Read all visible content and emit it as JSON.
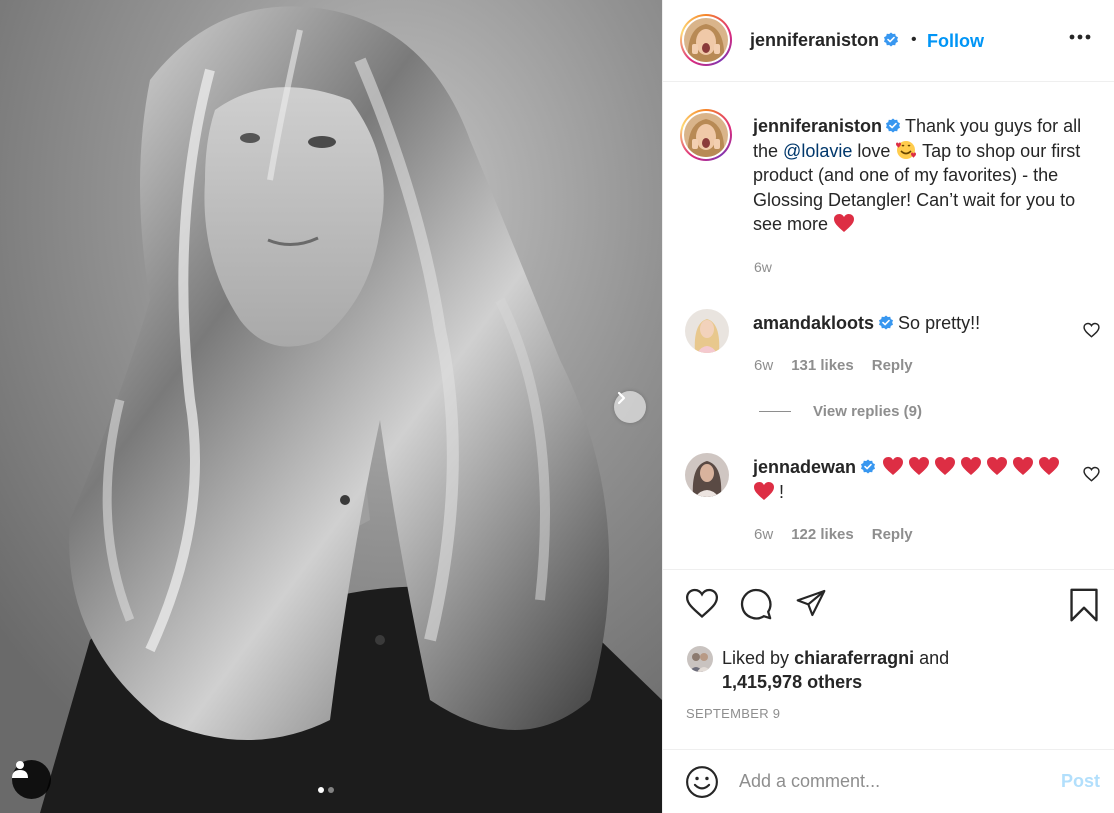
{
  "post": {
    "author": "jenniferaniston",
    "header_separator": "•",
    "follow_label": "Follow",
    "caption_text_1": "Thank you guys for all the",
    "caption_mention": "@lolavie",
    "caption_text_2": "love",
    "caption_text_3": "Tap to shop our first product (and one of my favorites) - the Glossing Detangler! Can’t wait for you to see more",
    "caption_time": "6w",
    "carousel_slides": 2,
    "carousel_active_index": 0
  },
  "comments": [
    {
      "user": "amandakloots",
      "text": "So pretty!!",
      "time": "6w",
      "likes": "131 likes",
      "reply_label": "Reply",
      "view_replies": "View replies (9)"
    },
    {
      "user": "jennadewan",
      "text": "!",
      "heart_count": 8,
      "time": "6w",
      "likes": "122 likes",
      "reply_label": "Reply"
    }
  ],
  "likes": {
    "prefix": "Liked by",
    "user": "chiaraferragni",
    "joiner": "and",
    "others": "1,415,978 others"
  },
  "date": "SEPTEMBER 9",
  "comment_box": {
    "placeholder": "Add a comment...",
    "post_label": "Post"
  },
  "icons": {
    "verified": "verified-badge-icon",
    "more": "more-options-icon",
    "like": "heart-icon",
    "comment": "comment-bubble-icon",
    "share": "paper-plane-icon",
    "save": "bookmark-icon",
    "emoji": "smiley-icon",
    "next": "chevron-right-icon",
    "tag": "user-tag-icon"
  },
  "colors": {
    "accent": "#0095f6",
    "verified": "#3897f0",
    "mention": "#00376b",
    "muted": "#8e8e8e",
    "heart": "#ed4956",
    "post_disabled": "#b2dffc"
  }
}
